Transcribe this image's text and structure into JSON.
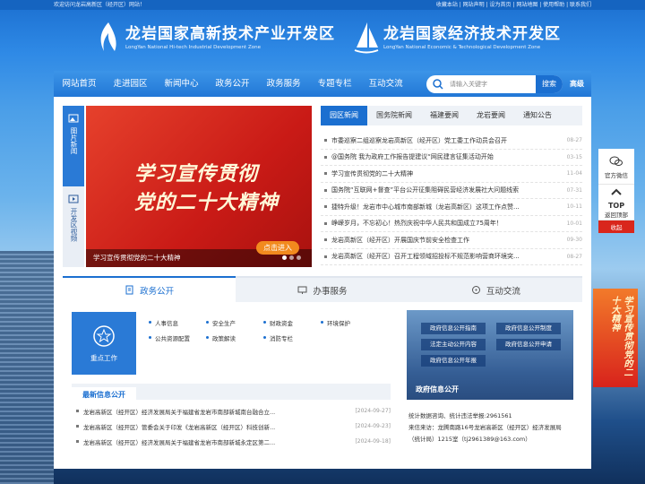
{
  "topbar": {
    "welcome": "欢迎访问龙岩高新区（经开区）网站！",
    "links": "收藏本站 | 网站声明 | 设为首页 | 网站地图 | 使用帮助 | 联系我们"
  },
  "logos": [
    {
      "cn": "龙岩国家高新技术产业开发区",
      "en": "LongYan National Hi-tech Industrial Development Zone"
    },
    {
      "cn": "龙岩国家经济技术开发区",
      "en": "LongYan National Economic & Technological Development Zone"
    }
  ],
  "nav": [
    "网站首页",
    "走进园区",
    "新闻中心",
    "政务公开",
    "政务服务",
    "专题专栏",
    "互动交流"
  ],
  "search": {
    "placeholder": "请输入关键字",
    "button": "搜索",
    "advanced": "高级"
  },
  "sidetabs": [
    "图片新闻",
    "开发区视频"
  ],
  "banner": {
    "line1": "学习宣传贯彻",
    "line2": "党的二十大精神",
    "caption": "学习宣传贯彻党的二十大精神",
    "button": "点击进入"
  },
  "newstabs": [
    "园区新闻",
    "国务院新闻",
    "福建要闻",
    "龙岩要闻",
    "通知公告"
  ],
  "news": [
    {
      "title": "市委巡察二组巡察龙岩高新区（经开区）党工委工作动员会召开",
      "date": "08-27"
    },
    {
      "title": "@国务院 我为政府工作报告提建议“网民建言征集活动开始",
      "date": "03-15"
    },
    {
      "title": "学习宣传贯彻党的二十大精神",
      "date": "11-04"
    },
    {
      "title": "国务院“互联网+督查”平台公开征集阻碍民营经济发展社大问题线索",
      "date": "07-31"
    },
    {
      "title": "捷特升级！龙岩市中心城市南部新城（龙岩高新区）这项工作点赞...",
      "date": "10-11"
    },
    {
      "title": "峥嵘岁月，不忘初心！热烈庆祝中华人民共和国成立75周年！",
      "date": "10-01"
    },
    {
      "title": "龙岩高新区（经开区）开展国庆节前安全检查工作",
      "date": "09-30"
    },
    {
      "title": "龙岩高新区（经开区）召开工程领域招投标不规范影响营商环境突...",
      "date": "08-27"
    }
  ],
  "sections": [
    "政务公开",
    "办事服务",
    "互动交流"
  ],
  "keywork": "重点工作",
  "govlinks": [
    [
      "人事信息",
      "安全生产",
      "财政资金",
      "环境保护"
    ],
    [
      "公共资源配置",
      "政策解读",
      "消防专栏"
    ]
  ],
  "info_header": "最新信息公开",
  "info": [
    {
      "title": "龙岩高新区（经开区）经济发展局关于福建省龙岩市南部新城南台融合立...",
      "date": "[2024-09-27]"
    },
    {
      "title": "龙岩高新区（经开区）管委会关于印发《龙岩高新区（经开区）科技创新...",
      "date": "[2024-09-23]"
    },
    {
      "title": "龙岩高新区（经开区）经济发展局关于福建省龙岩市南部新城永定区第二...",
      "date": "[2024-09-18]"
    }
  ],
  "govpanel": {
    "buttons": [
      "政府信息公开指南",
      "政府信息公开制度",
      "法定主动公开内容",
      "政府信息公开申请",
      "政府信息公开年报"
    ],
    "title": "政府信息公开"
  },
  "contact": [
    "统计数据咨询、统计违法举报:2961561",
    "来信来访：龙腾南路16号龙岩高新区（经开区）经济发展局",
    "（统计局）1215室（tj2961389@163.com）"
  ],
  "float": {
    "wechat": "官方微信",
    "top": "TOP",
    "back": "返回顶部",
    "close": "收起"
  },
  "sidepost": "学习宣传贯彻党的二十大精神",
  "colors": {
    "brand": "#1b6fd0",
    "banner": "#c91a16"
  }
}
